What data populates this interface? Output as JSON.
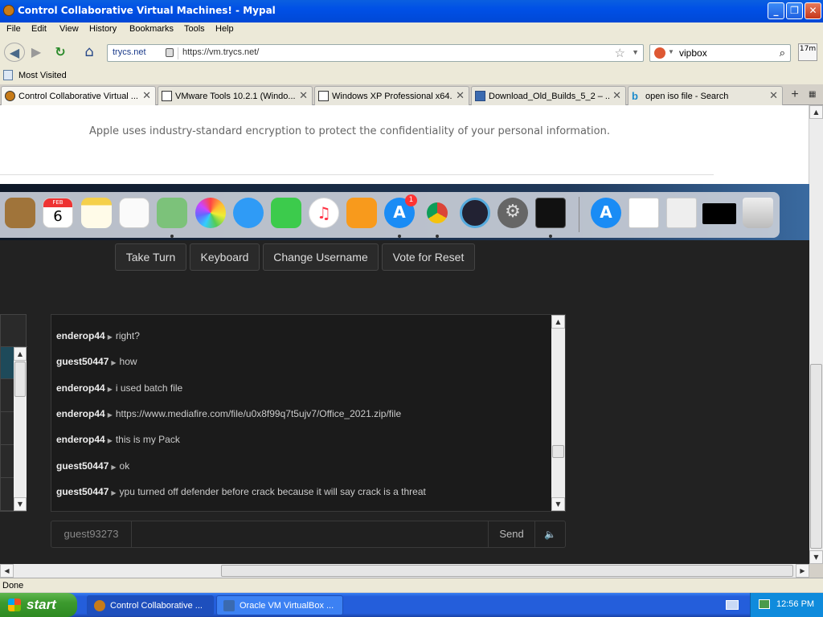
{
  "window": {
    "title": "Control Collaborative Virtual Machines! - Mypal",
    "min": "_",
    "max": "❐",
    "close": "✕"
  },
  "menu": [
    {
      "label": "File"
    },
    {
      "label": "Edit"
    },
    {
      "label": "View"
    },
    {
      "label": "History"
    },
    {
      "label": "Bookmarks"
    },
    {
      "label": "Tools"
    },
    {
      "label": "Help"
    }
  ],
  "nav": {
    "back": "◀",
    "forward": "▶",
    "reload": "↻",
    "home": "⌂",
    "site_identity": "trycs.net",
    "url": "https://vm.trycs.net/",
    "search_value": "vipbox",
    "toolbar_badge": "17m"
  },
  "bookmarks": {
    "most_visited": "Most Visited"
  },
  "tabs": [
    {
      "label": "Control Collaborative Virtual ...",
      "active": true
    },
    {
      "label": "VMware Tools 10.2.1 (Windo..."
    },
    {
      "label": "Windows XP Professional x64..."
    },
    {
      "label": "Download_Old_Builds_5_2 – ..."
    },
    {
      "label": "open iso file - Search"
    }
  ],
  "page": {
    "encryption_notice": "Apple uses industry-standard encryption to protect the confidentiality of your personal information.",
    "dock_badge": "1",
    "calendar_month": "FEB",
    "calendar_day": "6",
    "buttons": {
      "take_turn": "Take Turn",
      "keyboard": "Keyboard",
      "change_username": "Change Username",
      "vote_reset": "Vote for Reset"
    },
    "chat": {
      "messages": [
        {
          "user": "enderop44",
          "text": "right?"
        },
        {
          "user": "guest50447",
          "text": "how"
        },
        {
          "user": "enderop44",
          "text": "i used batch file"
        },
        {
          "user": "enderop44",
          "text": "https://www.mediafire.com/file/u0x8f99q7t5ujv7/Office_2021.zip/file"
        },
        {
          "user": "enderop44",
          "text": "this is my Pack"
        },
        {
          "user": "guest50447",
          "text": "ok"
        },
        {
          "user": "guest50447",
          "text": "ypu turned off defender before crack because it will say crack is a threat"
        }
      ],
      "username": "guest93273",
      "send_label": "Send",
      "volume_icon": "🔈"
    }
  },
  "status": {
    "text": "Done"
  },
  "taskbar": {
    "start": "start",
    "items": [
      {
        "label": "Control Collaborative ...",
        "active": true
      },
      {
        "label": "Oracle VM VirtualBox ..."
      }
    ],
    "clock": "12:56 PM"
  }
}
